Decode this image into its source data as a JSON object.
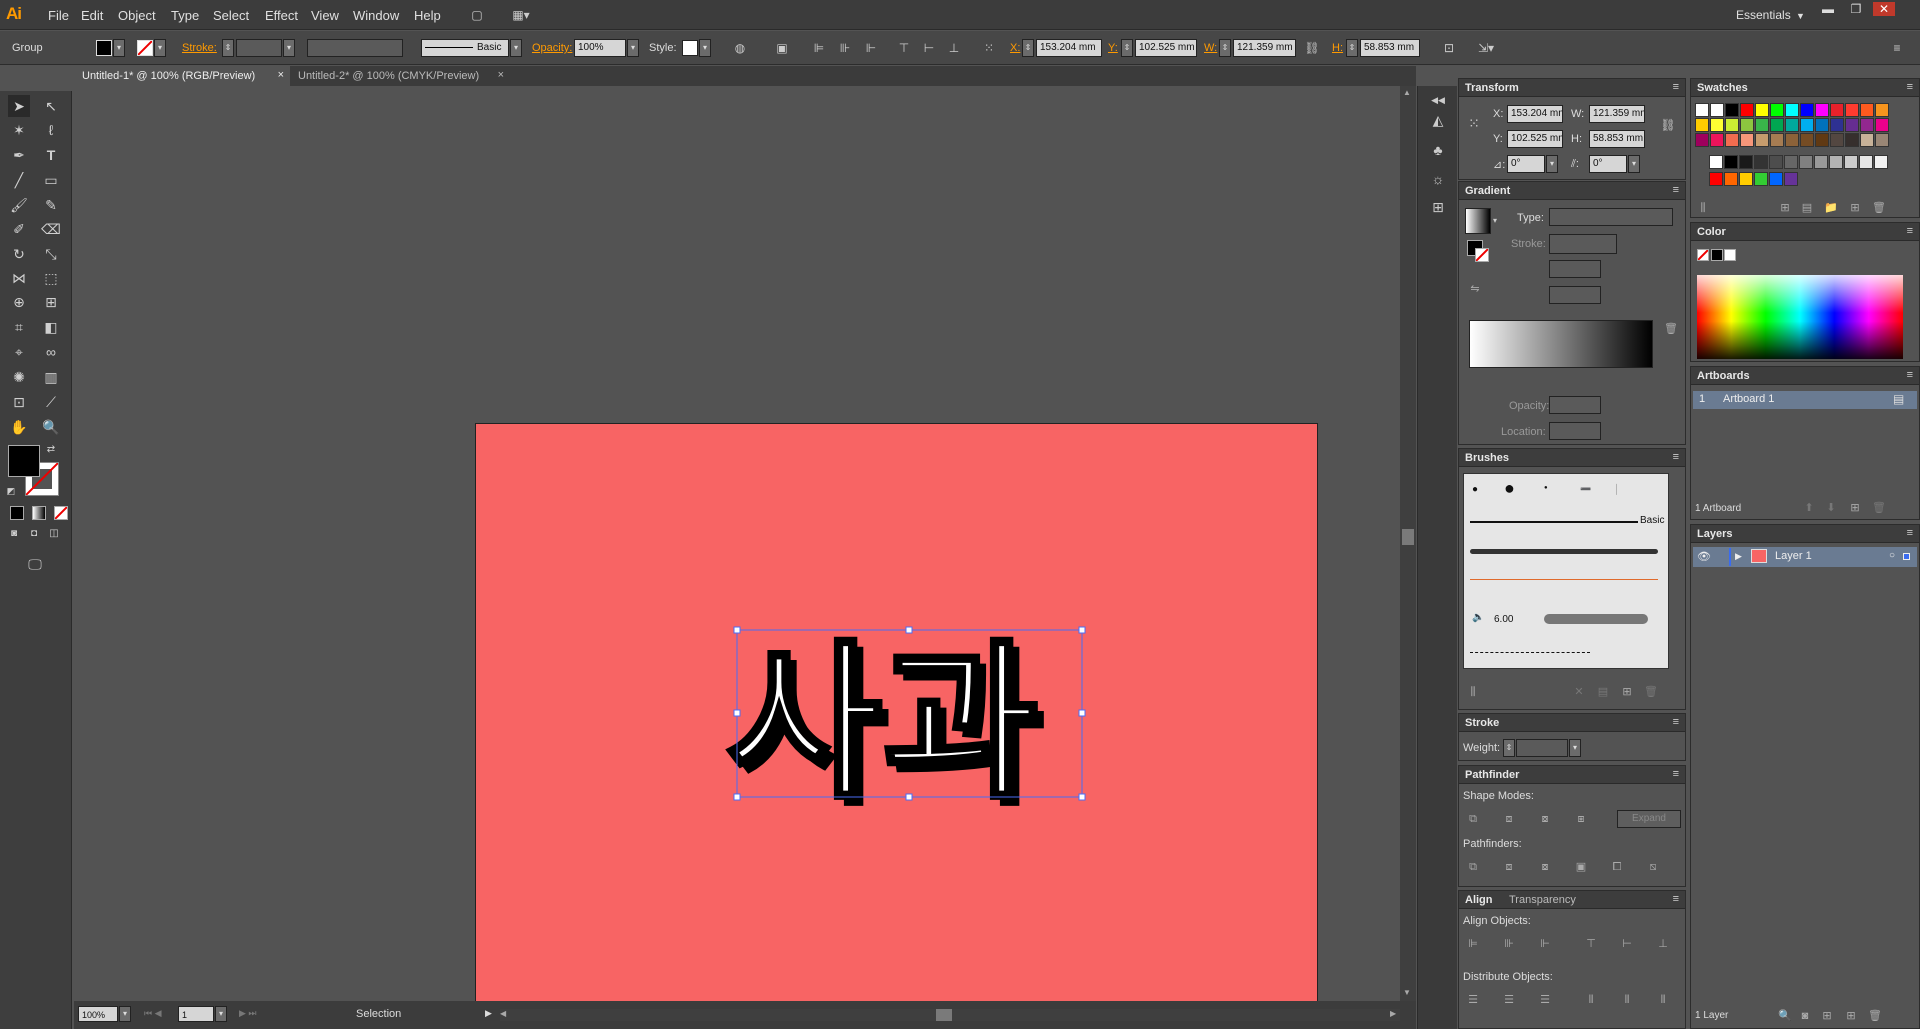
{
  "app": {
    "logo": "Ai"
  },
  "menu": [
    "File",
    "Edit",
    "Object",
    "Type",
    "Select",
    "Effect",
    "View",
    "Window",
    "Help"
  ],
  "workspace": "Essentials",
  "control": {
    "selection_type": "Group",
    "stroke_label": "Stroke:",
    "brush_label": "Basic",
    "opacity_label": "Opacity:",
    "opacity_value": "100%",
    "style_label": "Style:",
    "x_label": "X:",
    "x_value": "153.204 mm",
    "y_label": "Y:",
    "y_value": "102.525 mm",
    "w_label": "W:",
    "w_value": "121.359 mm",
    "h_label": "H:",
    "h_value": "58.853 mm"
  },
  "tabs": [
    {
      "label": "Untitled-1* @ 100% (RGB/Preview)",
      "close": "×"
    },
    {
      "label": "Untitled-2* @ 100% (CMYK/Preview)",
      "close": "×"
    }
  ],
  "artwork": {
    "text": "사과",
    "fill": "#ffffff",
    "shadow": "#000000",
    "artboard_color": "#f86464"
  },
  "status": {
    "zoom": "100%",
    "page": "1",
    "tool": "Selection"
  },
  "transform": {
    "title": "Transform",
    "x_label": "X:",
    "x": "153.204 mm",
    "w_label": "W:",
    "w": "121.359 mm",
    "y_label": "Y:",
    "y": "102.525 mm",
    "h_label": "H:",
    "h": "58.853 mm",
    "rot": "0°",
    "shear": "0°"
  },
  "gradient": {
    "title": "Gradient",
    "type_label": "Type:",
    "stroke_label": "Stroke:",
    "opacity_label": "Opacity:",
    "location_label": "Location:"
  },
  "brushes": {
    "title": "Brushes",
    "basic_label": "Basic",
    "size_value": "6.00"
  },
  "stroke": {
    "title": "Stroke",
    "weight_label": "Weight:"
  },
  "pathfinder": {
    "title": "Pathfinder",
    "shape_modes_label": "Shape Modes:",
    "expand_label": "Expand",
    "pathfinders_label": "Pathfinders:"
  },
  "align": {
    "title": "Align",
    "transparency_tab": "Transparency",
    "align_objects_label": "Align Objects:",
    "distribute_label": "Distribute Objects:"
  },
  "swatches": {
    "title": "Swatches",
    "row1": [
      "#ffffff",
      "#ffffff",
      "#000000",
      "#ff0000",
      "#ffff00",
      "#00ff00",
      "#00ffff",
      "#0000ff",
      "#ff00ff",
      "#e8212b",
      "#ff3b2f",
      "#ff5a1f",
      "#f7941d"
    ],
    "row2": [
      "#ffcc00",
      "#ffff33",
      "#ccee33",
      "#8cc63f",
      "#39b54a",
      "#00a651",
      "#00a99d",
      "#00aeef",
      "#0072bc",
      "#2e3192",
      "#662d91",
      "#92278f",
      "#ec008c"
    ],
    "row3": [
      "#9e005d",
      "#ed145b",
      "#f26c4f",
      "#f7977a",
      "#c69c6d",
      "#a67c52",
      "#8c6239",
      "#754c24",
      "#603913",
      "#534741",
      "#362f2d",
      "#c7b299",
      "#998675"
    ],
    "gray": [
      "#ffffff",
      "#000000",
      "#1a1a1a",
      "#333333",
      "#4d4d4d",
      "#666666",
      "#808080",
      "#999999",
      "#b3b3b3",
      "#cccccc",
      "#e6e6e6",
      "#f2f2f2"
    ],
    "group": [
      "#ff0000",
      "#ff6600",
      "#ffcc00",
      "#33cc33",
      "#0066ff",
      "#663399"
    ]
  },
  "color": {
    "title": "Color"
  },
  "artboards": {
    "title": "Artboards",
    "row_num": "1",
    "row_name": "Artboard 1",
    "count": "1 Artboard"
  },
  "layers": {
    "title": "Layers",
    "layer_name": "Layer 1",
    "count": "1 Layer"
  }
}
